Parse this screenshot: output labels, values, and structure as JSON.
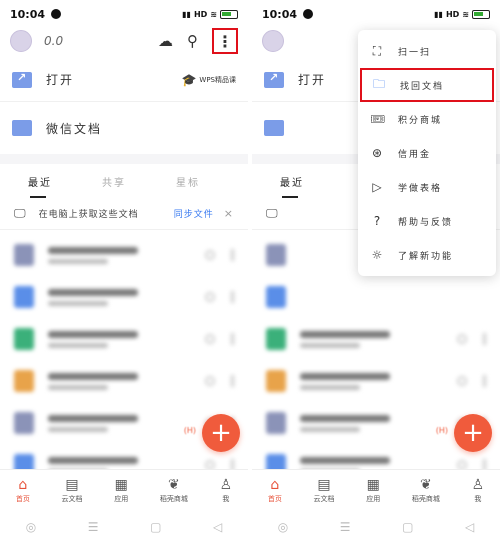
{
  "status_bar": {
    "time": "10:04",
    "network": "HD",
    "battery": "●"
  },
  "header": {
    "storage": "0.0"
  },
  "quick": {
    "open_label": "打开",
    "wps_label": "WPS精品课",
    "secure_label": "微信文档"
  },
  "tabs": [
    "最近",
    "共享",
    "星标"
  ],
  "notice": {
    "text": "在电脑上获取这些文档",
    "action": "同步文件",
    "close": "×"
  },
  "doc_colors": [
    "#8b93b8",
    "#5a8ee8",
    "#3bb07a",
    "#e8a34a",
    "#8b93b8",
    "#5a8ee8"
  ],
  "fab": {
    "symbol": "+",
    "mini": "(H)"
  },
  "bottom_nav": [
    "首页",
    "云文档",
    "应用",
    "稻壳商城",
    "我"
  ],
  "menu": {
    "items": [
      {
        "label": "扫一扫",
        "icon": "scan-icon"
      },
      {
        "label": "找回文档",
        "icon": "recover-folder-icon"
      },
      {
        "label": "积分商城",
        "icon": "ticket-icon"
      },
      {
        "label": "信用金",
        "icon": "credit-icon"
      },
      {
        "label": "学做表格",
        "icon": "video-icon"
      },
      {
        "label": "帮助与反馈",
        "icon": "help-icon"
      },
      {
        "label": "了解新功能",
        "icon": "bulb-icon"
      }
    ]
  },
  "colors": {
    "accent": "#e7523a",
    "highlight_border": "#e0101a",
    "folder": "#7b9ce8",
    "link": "#3b7bf0"
  }
}
